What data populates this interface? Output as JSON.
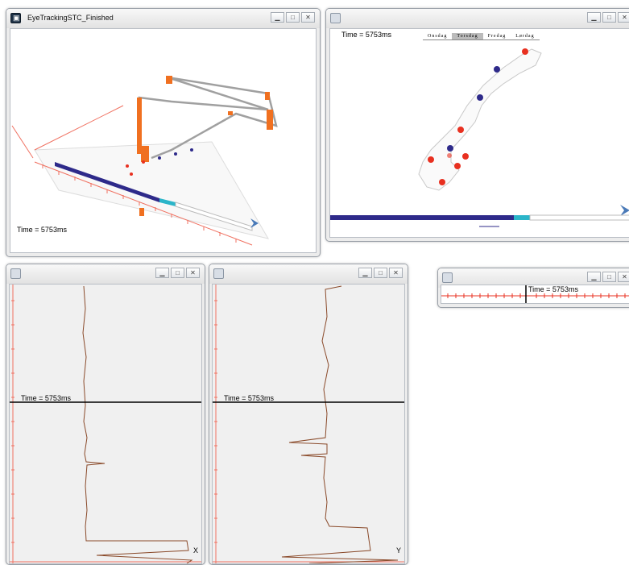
{
  "time_label": "Time = 5753ms",
  "win_stc": {
    "title": "EyeTrackingSTC_Finished"
  },
  "win_map": {
    "tabs": [
      "Onsdag",
      "Torsdag",
      "Fredag",
      "Lørdag"
    ],
    "active_tab": 1
  },
  "win_x": {
    "axis_label": "X"
  },
  "win_y": {
    "axis_label": "Y"
  },
  "colors": {
    "accent_blue": "#2e2a8a",
    "highlight_cyan": "#2bb5c9",
    "point_red": "#e83020",
    "ruler_red": "#f07060",
    "trace_brown": "#8a4a2a",
    "marker_orange": "#f07020"
  },
  "controls": {
    "minimize": "minimize-icon",
    "maximize": "maximize-icon",
    "close": "close-icon"
  }
}
